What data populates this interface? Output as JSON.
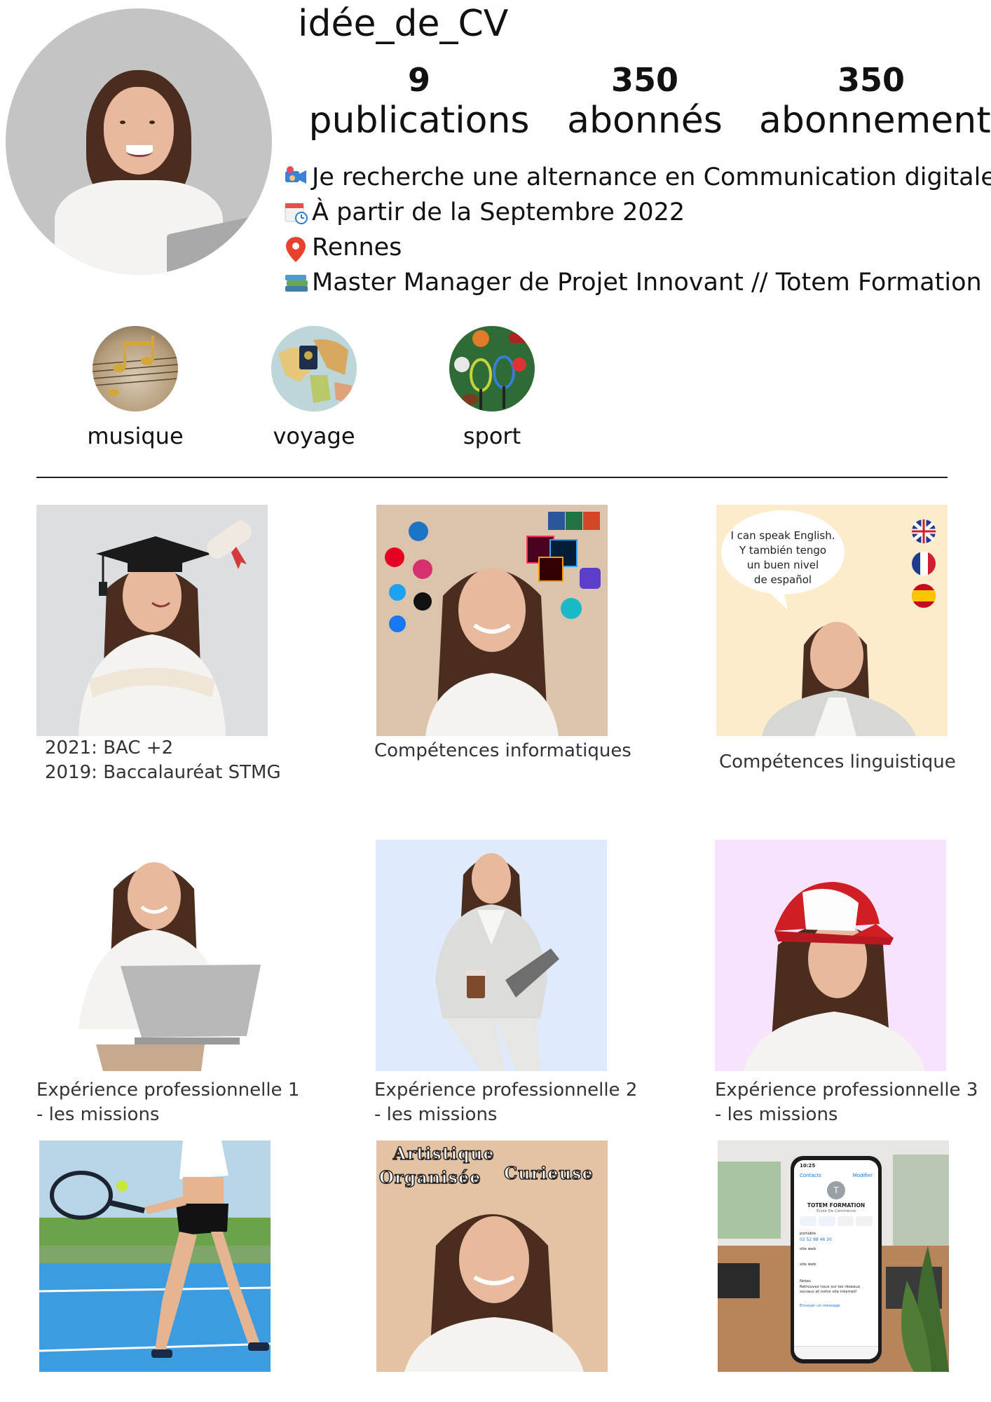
{
  "profile": {
    "username": "idée_de_CV",
    "stats": [
      {
        "value": "9",
        "label": "publications"
      },
      {
        "value": "350",
        "label": "abonnés"
      },
      {
        "value": "350",
        "label": "abonnements"
      }
    ],
    "bio": [
      {
        "icon": "video-call-icon",
        "text": "Je recherche une alternance en Communication digitale"
      },
      {
        "icon": "calendar-clock-icon",
        "text": "À partir de la Septembre 2022"
      },
      {
        "icon": "location-pin-icon",
        "text": "Rennes"
      },
      {
        "icon": "books-icon",
        "text": "Master Manager de Projet Innovant // Totem Formation"
      }
    ]
  },
  "highlights": [
    {
      "label": "musique"
    },
    {
      "label": "voyage"
    },
    {
      "label": "sport"
    }
  ],
  "posts": [
    {
      "caption": [
        "2021: BAC +2",
        "2019: Baccalauréat STMG"
      ]
    },
    {
      "caption": [
        "Compétences informatiques"
      ]
    },
    {
      "caption": [
        "Compétences linguistique"
      ],
      "bubble": [
        "I can speak English.",
        "Y también tengo",
        "un buen nivel",
        "de español"
      ]
    },
    {
      "caption": [
        "Expérience professionnelle 1",
        "- les missions"
      ]
    },
    {
      "caption": [
        "Expérience professionnelle 2",
        "- les missions"
      ]
    },
    {
      "caption": [
        "Expérience professionnelle 3",
        "- les missions"
      ]
    },
    {
      "caption": []
    },
    {
      "caption": [],
      "words": [
        "Artistique",
        "Organisée",
        "Curieuse"
      ]
    },
    {
      "caption": [],
      "phone": {
        "time": "10:25",
        "back": "Contacts",
        "edit": "Modifier",
        "initial": "T",
        "name": "TOTEM FORMATION",
        "subtitle": "École De Commerce",
        "phone_label": "portable",
        "phone_value": "02 52 88 46 30",
        "web_label": "site web",
        "notes_label": "Notes",
        "notes": "Retrouvez nous sur les réseaux sociaux et notre site internet!",
        "send": "Envoyer un message"
      }
    }
  ],
  "colors": {
    "avatar_bg": "#c4c4c4",
    "tile_grad": "#dcdfe2",
    "tile_skills": "#dcc3ab",
    "tile_lang": "#fdeccb",
    "tile_exp2": "#dfeafd",
    "tile_exp3": "#f8e3fc",
    "tile_qualities": "#e4c2a4"
  }
}
